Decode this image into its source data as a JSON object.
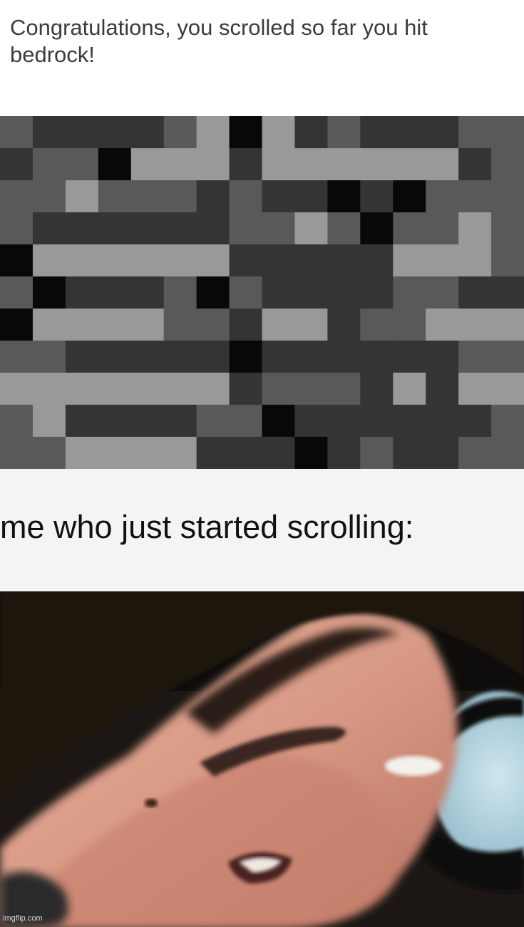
{
  "top_caption": "Congratulations, you scrolled so far you hit bedrock!",
  "mid_caption": "me who just started scrolling:",
  "watermark": "imgflip.com",
  "colors": {
    "bedrock_black": "#080808",
    "bedrock_dark": "#343434",
    "bedrock_mid": "#595959",
    "bedrock_light": "#999999",
    "caption_bg": "#f4f4f4",
    "skin": "#d89a86"
  },
  "images": {
    "bedrock_texture": "bedrock-block-texture",
    "reaction_photo": "distorted-face-closeup-photo"
  }
}
